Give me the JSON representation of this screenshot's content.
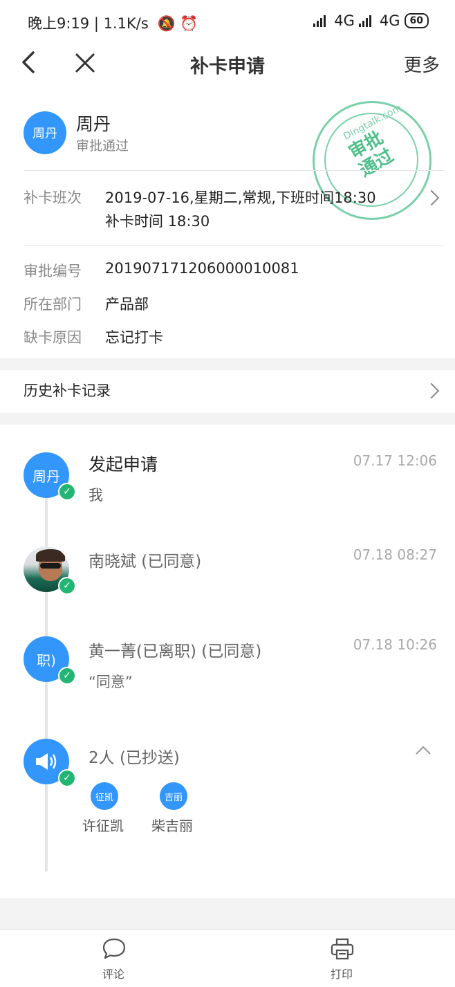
{
  "status_bar": {
    "left_text": "晚上9:19 | 1.1K/s",
    "network_1": "4G",
    "network_2": "4G",
    "battery": "60"
  },
  "nav": {
    "title": "补卡申请",
    "more_label": "更多"
  },
  "applicant": {
    "avatar_text": "周丹",
    "name": "周丹",
    "status": "审批通过",
    "stamp_site": "Dingtalk.com",
    "stamp_text_line1": "审批",
    "stamp_text_line2": "通过",
    "stamp_color": "#3fb980"
  },
  "shift": {
    "label": "补卡班次",
    "value_line1": "2019-07-16,星期二,常规,下班时间18:30",
    "value_line2": "补卡时间 18:30"
  },
  "details": [
    {
      "label": "审批编号",
      "value": "20190717120600001​0081"
    },
    {
      "label": "所在部门",
      "value": "产品部"
    },
    {
      "label": "缺卡原因",
      "value": "忘记打卡"
    }
  ],
  "history": {
    "label": "历史补卡记录"
  },
  "timeline": [
    {
      "avatar_text": "周丹",
      "title": "发起申请",
      "time": "07.17 12:06",
      "sub": "我"
    },
    {
      "avatar_text": "",
      "title": "南晓斌 (已同意)",
      "time": "07.18 08:27",
      "sub": ""
    },
    {
      "avatar_text": "职)",
      "title": "黄一菁(已离职) (已同意)",
      "time": "07.18 10:26",
      "sub": "“同意”"
    },
    {
      "avatar_text": "",
      "title": "2人 (已抄送)",
      "time": "",
      "sub": ""
    }
  ],
  "cc": [
    {
      "avatar_text": "征凯",
      "name": "许征凯"
    },
    {
      "avatar_text": "吉丽",
      "name": "柴吉丽"
    }
  ],
  "bottom_bar": {
    "comment_label": "评论",
    "print_label": "打印"
  },
  "colors": {
    "accent": "#3296fa",
    "check": "#22b573"
  }
}
